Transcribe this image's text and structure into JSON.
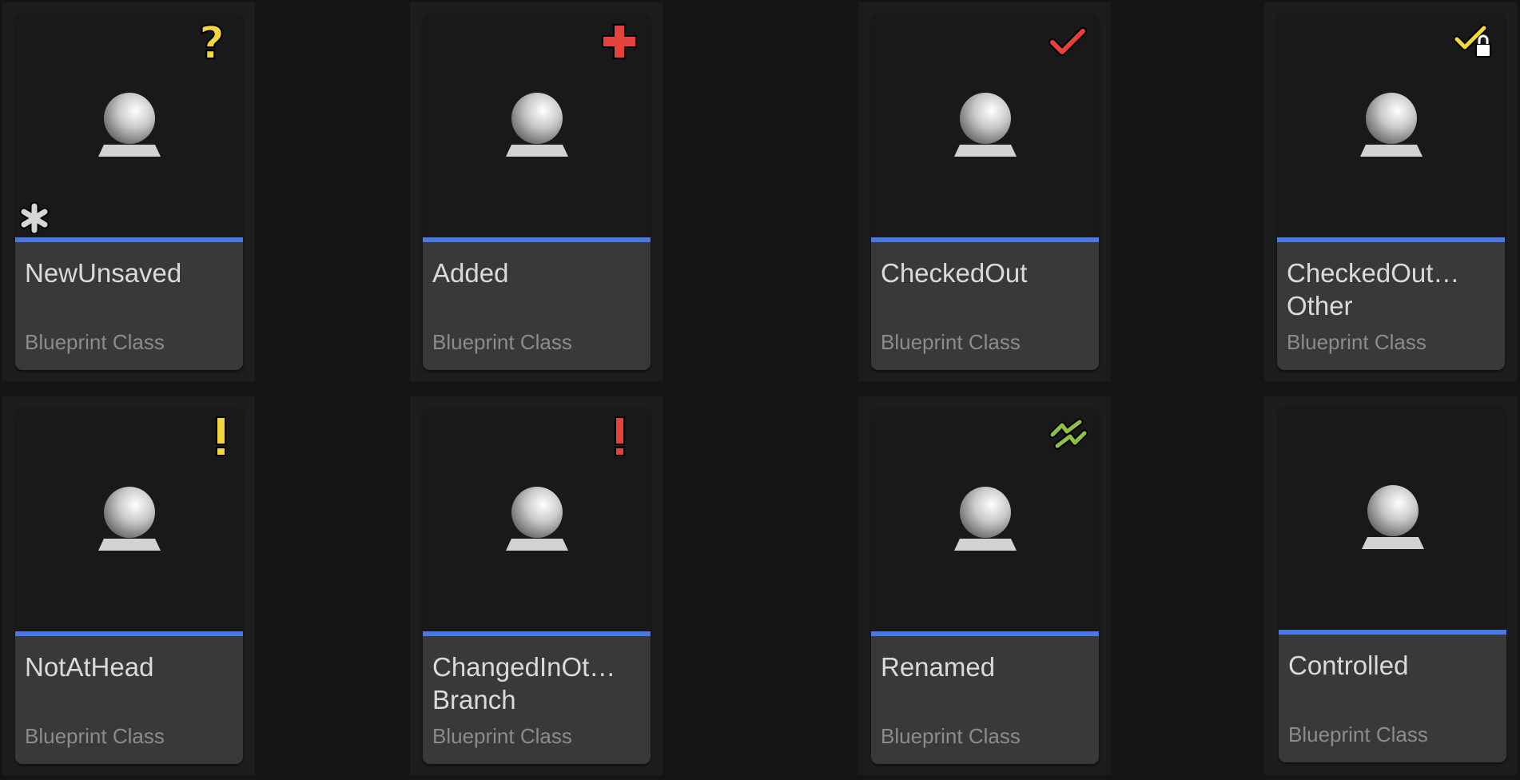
{
  "colors": {
    "background": "#151515",
    "cell": "#1d1d1d",
    "thumbnail": "#191919",
    "info_panel": "#393939",
    "accent_bar": "#4a78e6",
    "name_text": "#dadada",
    "type_text": "#8c8c8c",
    "yellow": "#f5d53d",
    "red": "#e6413b",
    "green": "#8fbf45",
    "white": "#ffffff"
  },
  "tiles": [
    {
      "name": "NewUnsaved",
      "type": "Blueprint Class",
      "status_icon": "question-icon",
      "status_color": "yellow",
      "unsaved": true
    },
    {
      "name": "Added",
      "type": "Blueprint Class",
      "status_icon": "plus-icon",
      "status_color": "red"
    },
    {
      "name": "CheckedOut",
      "type": "Blueprint Class",
      "status_icon": "checkmark-icon",
      "status_color": "red"
    },
    {
      "name": "CheckedOut…\nOther",
      "type": "Blueprint Class",
      "status_icon": "checkmark-lock-icon",
      "status_color": "yellow"
    },
    {
      "name": "NotAtHead",
      "type": "Blueprint Class",
      "status_icon": "exclamation-icon",
      "status_color": "yellow"
    },
    {
      "name": "ChangedInOt…\nBranch",
      "type": "Blueprint Class",
      "status_icon": "exclamation-icon",
      "status_color": "red"
    },
    {
      "name": "Renamed",
      "type": "Blueprint Class",
      "status_icon": "renamed-arrows-icon",
      "status_color": "green"
    },
    {
      "name": "Controlled",
      "type": "Blueprint Class",
      "status_icon": "none"
    }
  ]
}
